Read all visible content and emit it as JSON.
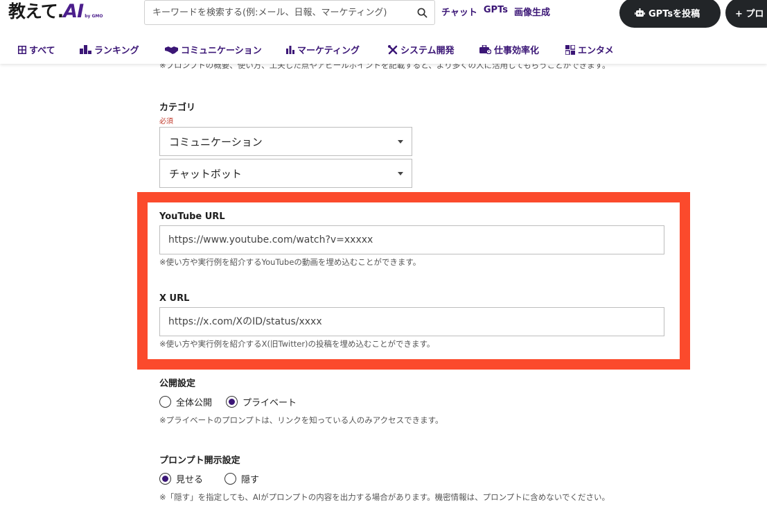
{
  "header": {
    "logo_text": "教えて.",
    "logo_ai": "AI",
    "logo_by": "by GMO",
    "search_placeholder": "キーワードを検索する(例:メール、日報、マーケティング)",
    "links": [
      "チャット",
      "GPTs",
      "画像生成"
    ],
    "gpts_button": "GPTsを投稿",
    "prompt_button": "+ プロ",
    "accent": "#3b1676"
  },
  "categories": [
    {
      "label": "すべて",
      "icon": "grid-icon"
    },
    {
      "label": "ランキング",
      "icon": "podium-icon"
    },
    {
      "label": "コミュニケーション",
      "icon": "handshake-icon"
    },
    {
      "label": "マーケティング",
      "icon": "bar-chart-icon"
    },
    {
      "label": "システム開発",
      "icon": "tools-icon"
    },
    {
      "label": "仕事効率化",
      "icon": "briefcase-icon"
    },
    {
      "label": "エンタメ",
      "icon": "puzzle-icon"
    }
  ],
  "form": {
    "top_hint": "※プロンプトの概要、使い方、工夫した点やアピールポイントを記載すると、より多くの人に活用してもらうことができます。",
    "category": {
      "label": "カテゴリ",
      "required": "必須",
      "primary": "コミュニケーション",
      "secondary": "チャットボット"
    },
    "youtube": {
      "label": "YouTube URL",
      "placeholder": "https://www.youtube.com/watch?v=xxxxx",
      "help": "※使い方や実行例を紹介するYouTubeの動画を埋め込むことができます。"
    },
    "x": {
      "label": "X URL",
      "placeholder": "https://x.com/XのID/status/xxxx",
      "help": "※使い方や実行例を紹介するX(旧Twitter)の投稿を埋め込むことができます。"
    },
    "visibility": {
      "label": "公開設定",
      "options": [
        "全体公開",
        "プライベート"
      ],
      "selected": "プライベート",
      "help": "※プライベートのプロンプトは、リンクを知っている人のみアクセスできます。"
    },
    "disclosure": {
      "label": "プロンプト開示設定",
      "options": [
        "見せる",
        "隠す"
      ],
      "selected": "見せる",
      "help": "※「隠す」を指定しても、AIがプロンプトの内容を出力する場合があります。機密情報は、プロンプトに含めないでください。"
    },
    "highlight_color": "#fb4a2c"
  }
}
